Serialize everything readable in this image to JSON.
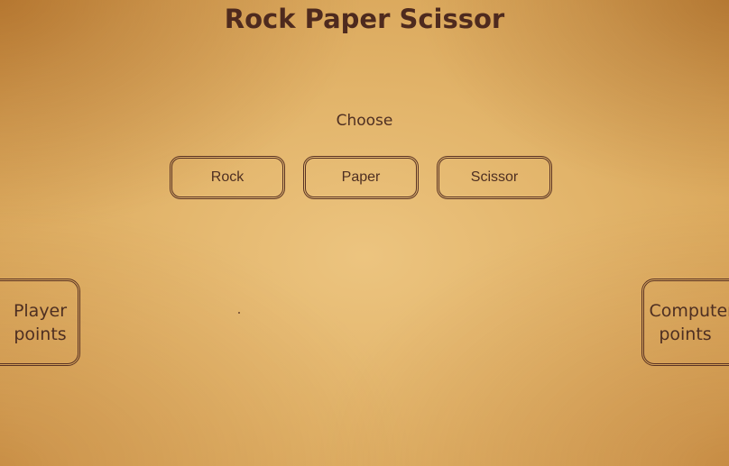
{
  "header": {
    "title": "Rock Paper Scissor"
  },
  "prompt": {
    "label": "Choose"
  },
  "choices": [
    {
      "label": "Rock"
    },
    {
      "label": "Paper"
    },
    {
      "label": "Scissor"
    }
  ],
  "scores": {
    "player_label": "Player points",
    "computer_label": "Computer points"
  },
  "colors": {
    "text": "#4e2a1e",
    "border": "#5a3324",
    "background": "#e2b46a"
  }
}
